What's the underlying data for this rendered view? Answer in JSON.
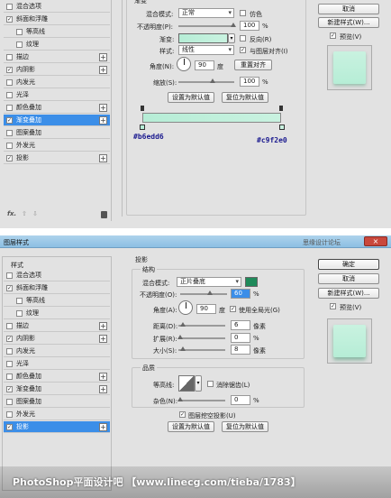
{
  "p1": {
    "sidebar": [
      {
        "label": "混合选项",
        "check": "",
        "checked": false,
        "plus": false,
        "indent": false,
        "active": false
      },
      {
        "label": "斜面和浮雕",
        "check": "✓",
        "checked": true,
        "plus": false,
        "indent": false,
        "active": false
      },
      {
        "label": "等高线",
        "check": "",
        "checked": false,
        "plus": false,
        "indent": true,
        "active": false
      },
      {
        "label": "纹理",
        "check": "",
        "checked": false,
        "plus": false,
        "indent": true,
        "active": false
      },
      {
        "label": "描边",
        "check": "",
        "checked": false,
        "plus": true,
        "indent": false,
        "active": false
      },
      {
        "label": "内阴影",
        "check": "✓",
        "checked": true,
        "plus": true,
        "indent": false,
        "active": false
      },
      {
        "label": "内发光",
        "check": "",
        "checked": false,
        "plus": false,
        "indent": false,
        "active": false
      },
      {
        "label": "光泽",
        "check": "",
        "checked": false,
        "plus": false,
        "indent": false,
        "active": false
      },
      {
        "label": "颜色叠加",
        "check": "",
        "checked": false,
        "plus": true,
        "indent": false,
        "active": false
      },
      {
        "label": "渐变叠加",
        "check": "✓",
        "checked": true,
        "plus": true,
        "indent": false,
        "active": true
      },
      {
        "label": "图案叠加",
        "check": "",
        "checked": false,
        "plus": false,
        "indent": false,
        "active": false
      },
      {
        "label": "外发光",
        "check": "",
        "checked": false,
        "plus": false,
        "indent": false,
        "active": false
      },
      {
        "label": "投影",
        "check": "✓",
        "checked": true,
        "plus": true,
        "indent": false,
        "active": false
      }
    ],
    "bottom_fx": "fx.",
    "bottom_up": "⇧",
    "bottom_down": "⇩",
    "bottom_trash": "🗑",
    "header_cut": "渐变",
    "blend_label": "混合模式:",
    "blend_value": "正常",
    "dither_label": "仿色",
    "opacity_label": "不透明度(P):",
    "opacity_value": "100",
    "opacity_unit": "%",
    "gradient_label": "渐变:",
    "reverse_label": "反向(R)",
    "style_label": "样式:",
    "style_value": "线性",
    "align_label": "与图层对齐(I)",
    "angle_label": "角度(N):",
    "angle_value": "90",
    "angle_unit": "度",
    "reset_align": "重置对齐",
    "scale_label": "缩放(S):",
    "scale_value": "100",
    "scale_unit": "%",
    "set_default": "设置为默认值",
    "reset_default": "复位为默认值",
    "color_left": "#b6edd6",
    "color_right": "#c9f2e0",
    "color_left_label": "#b6edd6",
    "color_right_label": "#c9f2e0",
    "cancel": "取消",
    "new_style": "新建样式(W)...",
    "preview_label": "预览(V)"
  },
  "p2": {
    "window_title": "图层样式",
    "title_faded": "思缘设计论坛",
    "close": "×",
    "sidebar_header": "样式",
    "sidebar": [
      {
        "label": "混合选项",
        "check": "",
        "checked": false,
        "plus": false,
        "indent": false,
        "active": false
      },
      {
        "label": "斜面和浮雕",
        "check": "✓",
        "checked": true,
        "plus": false,
        "indent": false,
        "active": false
      },
      {
        "label": "等高线",
        "check": "",
        "checked": false,
        "plus": false,
        "indent": true,
        "active": false
      },
      {
        "label": "纹理",
        "check": "",
        "checked": false,
        "plus": false,
        "indent": true,
        "active": false
      },
      {
        "label": "描边",
        "check": "",
        "checked": false,
        "plus": true,
        "indent": false,
        "active": false
      },
      {
        "label": "内阴影",
        "check": "✓",
        "checked": true,
        "plus": true,
        "indent": false,
        "active": false
      },
      {
        "label": "内发光",
        "check": "",
        "checked": false,
        "plus": false,
        "indent": false,
        "active": false
      },
      {
        "label": "光泽",
        "check": "",
        "checked": false,
        "plus": false,
        "indent": false,
        "active": false
      },
      {
        "label": "颜色叠加",
        "check": "",
        "checked": false,
        "plus": true,
        "indent": false,
        "active": false
      },
      {
        "label": "渐变叠加",
        "check": "✓",
        "checked": true,
        "plus": true,
        "indent": false,
        "active": false
      },
      {
        "label": "图案叠加",
        "check": "",
        "checked": false,
        "plus": false,
        "indent": false,
        "active": false
      },
      {
        "label": "外发光",
        "check": "",
        "checked": false,
        "plus": false,
        "indent": false,
        "active": false
      },
      {
        "label": "投影",
        "check": "✓",
        "checked": true,
        "plus": true,
        "indent": false,
        "active": true
      }
    ],
    "section_title": "投影",
    "structure_title": "结构",
    "blend_label": "混合模式:",
    "blend_value": "正片叠底",
    "shadow_color": "#1f8a5a",
    "opacity_label": "不透明度(O):",
    "opacity_value": "60",
    "opacity_unit": "%",
    "angle_label": "角度(A):",
    "angle_value": "90",
    "angle_unit": "度",
    "global_light_label": "使用全局光(G)",
    "distance_label": "距离(D):",
    "distance_value": "6",
    "distance_unit": "像素",
    "spread_label": "扩展(R):",
    "spread_value": "0",
    "spread_unit": "%",
    "size_label": "大小(S):",
    "size_value": "8",
    "size_unit": "像素",
    "quality_title": "品质",
    "contour_label": "等高线:",
    "antialias_label": "消除锯齿(L)",
    "noise_label": "杂色(N):",
    "noise_value": "0",
    "noise_unit": "%",
    "knockout_label": "图层挖空投影(U)",
    "set_default": "设置为默认值",
    "reset_default": "复位为默认值",
    "ok": "确定",
    "cancel": "取消",
    "new_style": "新建样式(W)...",
    "preview_label": "预览(V)"
  },
  "watermark": "PhotoShop平面设计吧 【www.linecg.com/tieba/1783】",
  "colors": {
    "accent": "#3b8ee8",
    "preview_fill": "#bfefdb",
    "gradient_start": "#b6edd6",
    "gradient_end": "#c9f2e0"
  }
}
